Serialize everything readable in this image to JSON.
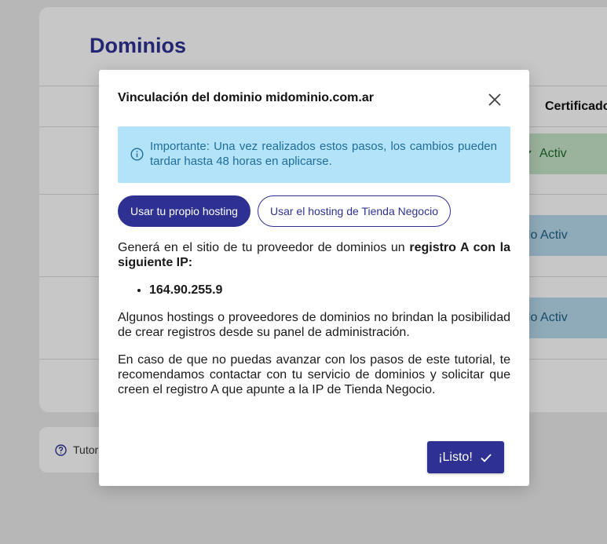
{
  "background": {
    "page_title": "Dominios",
    "column_header": "Certificado",
    "status_active": "Activ",
    "status_inactive": "No Activ",
    "tutorial_label": "Tutor"
  },
  "modal": {
    "title": "Vinculación del dominio midominio.com.ar",
    "alert_text": "Importante: Una vez realizados estos pasos, los cambios pueden tardar hasta 48 horas en aplicarse.",
    "tabs": [
      {
        "label": "Usar tu propio hosting",
        "active": true
      },
      {
        "label": "Usar el hosting de Tienda Negocio",
        "active": false
      }
    ],
    "instruction_prefix": "Generá en el sitio de tu proveedor de dominios un ",
    "instruction_bold": "registro A con la siguiente IP:",
    "ip_address": "164.90.255.9",
    "paragraph_1": "Algunos hostings o proveedores de dominios no brindan la posibilidad de crear registros desde su panel de administración.",
    "paragraph_2": "En caso de que no puedas avanzar con los pasos de este tutorial, te recomendamos contactar con tu servicio de dominios y solicitar que creen el registro A que apunte a la IP de Tienda Negocio.",
    "confirm_label": "¡Listo!"
  },
  "colors": {
    "brand": "#2e3192",
    "alert_bg": "#b3e3f8",
    "alert_text": "#1f6d9a",
    "success_bg": "#c7e6c9",
    "info_bg": "#b8dcef"
  },
  "icons": [
    "close-icon",
    "info-icon",
    "check-icon",
    "help-icon"
  ]
}
